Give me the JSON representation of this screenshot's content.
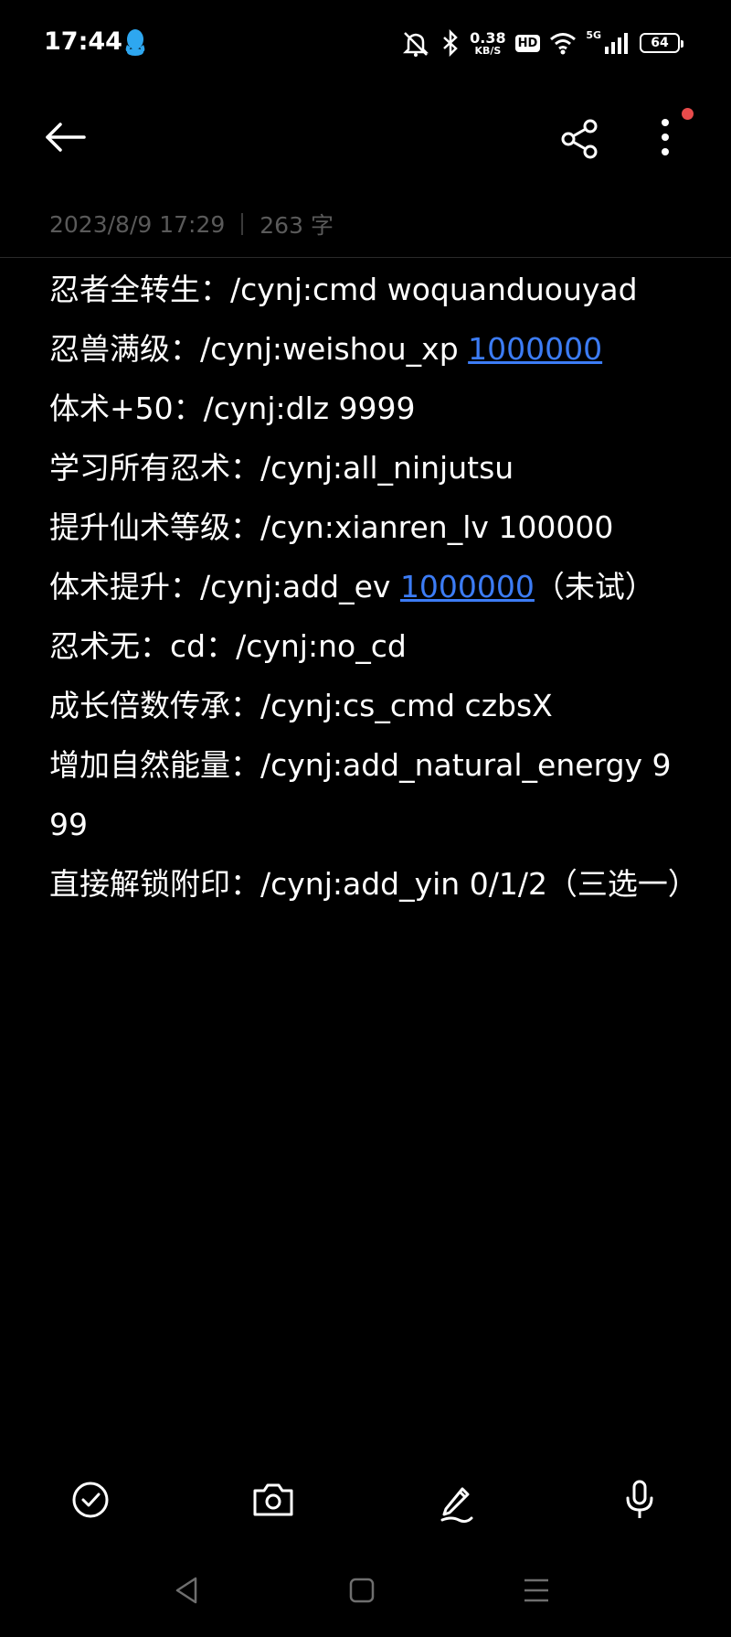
{
  "status_bar": {
    "time": "17:44",
    "net_speed_value": "0.38",
    "net_speed_unit": "KB/S",
    "hd_label": "HD",
    "network_label": "5G",
    "battery_level": "64",
    "icons": [
      "qq-icon",
      "mute-icon",
      "bluetooth-icon",
      "wifi-icon",
      "signal-icon",
      "battery-icon"
    ]
  },
  "header": {
    "back_icon": "back-arrow-icon",
    "share_icon": "share-icon",
    "more_icon": "more-vertical-icon",
    "notification_dot_color": "#e84b4b"
  },
  "note": {
    "date": "2023/8/9 17:29",
    "word_count": "263 字",
    "lines": [
      {
        "text": "忍者全转生：/cynj:cmd woquanduouyad"
      },
      {
        "before": "忍兽满级：/cynj:weishou_xp ",
        "link": "1000000",
        "after": ""
      },
      {
        "text": "体术+50：/cynj:dlz 9999"
      },
      {
        "text": "学习所有忍术：/cynj:all_ninjutsu"
      },
      {
        "text": "提升仙术等级：/cyn:xianren_lv 100000"
      },
      {
        "before": "体术提升：/cynj:add_ev ",
        "link": "1000000",
        "after": "（未试）"
      },
      {
        "text": "忍术无：cd：/cynj:no_cd"
      },
      {
        "text": "成长倍数传承：/cynj:cs_cmd czbsX"
      },
      {
        "text": "增加自然能量：/cynj:add_natural_energy 999"
      },
      {
        "text": "直接解锁附印：/cynj:add_yin 0/1/2（三选一）"
      }
    ],
    "link_color": "#3c7cf5"
  },
  "toolbar": {
    "icons": [
      "checklist-icon",
      "camera-icon",
      "pen-icon",
      "microphone-icon"
    ]
  },
  "nav_bar": {
    "icons": [
      "nav-back-icon",
      "nav-home-icon",
      "nav-recents-icon"
    ]
  }
}
